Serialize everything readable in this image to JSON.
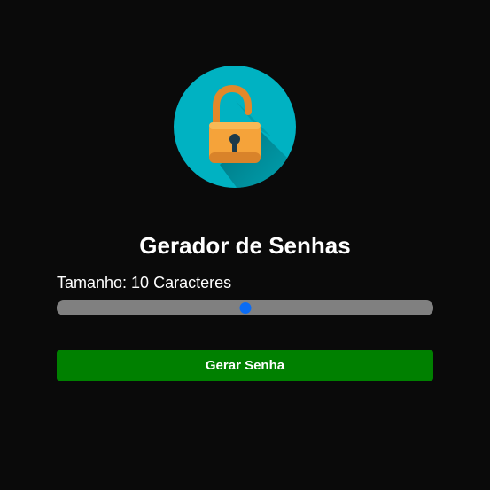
{
  "header": {
    "title": "Gerador de Senhas"
  },
  "logo": {
    "icon": "open-padlock-icon",
    "circle_color": "#00b2c2",
    "lock_color": "#f5a33a"
  },
  "length": {
    "label": "Tamanho: 10 Caracteres",
    "value_fraction": 0.5
  },
  "actions": {
    "generate_label": "Gerar Senha",
    "generate_color": "#008000"
  }
}
